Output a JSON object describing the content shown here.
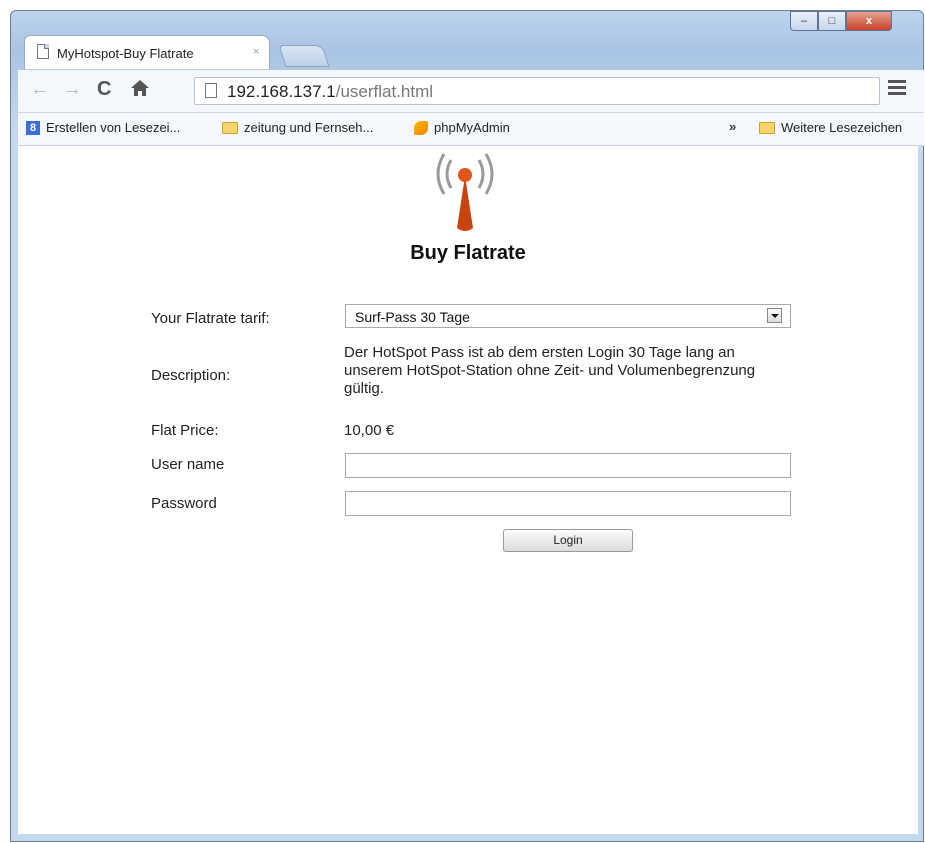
{
  "browser": {
    "tab_title": "MyHotspot-Buy Flatrate",
    "tab_close": "×",
    "url_host": "192.168.137.1",
    "url_path": "/userflat.html",
    "window_controls": {
      "minimize": "–",
      "maximize": "□",
      "close": "x"
    }
  },
  "bookmarks": {
    "items": [
      {
        "label": "Erstellen von Lesezei...",
        "icon": "g-icon"
      },
      {
        "label": "zeitung und Fernseh...",
        "icon": "folder-icon"
      },
      {
        "label": "phpMyAdmin",
        "icon": "phpmyadmin-icon"
      }
    ],
    "overflow": "»",
    "other": "Weitere Lesezeichen"
  },
  "page": {
    "title": "Buy Flatrate",
    "tarif_label": "Your Flatrate tarif:",
    "tarif_value": "Surf-Pass 30 Tage",
    "description_label": "Description:",
    "description_text": "Der HotSpot Pass ist ab dem ersten Login 30 Tage lang an unserem HotSpot-Station ohne Zeit- und Volumenbegrenzung gültig.",
    "price_label": "Flat Price:",
    "price_value": "10,00 €",
    "username_label": "User name",
    "password_label": "Password",
    "login_button": "Login"
  },
  "colors": {
    "logo_orange": "#d24a10",
    "window_frame": "#bcd4ee"
  }
}
